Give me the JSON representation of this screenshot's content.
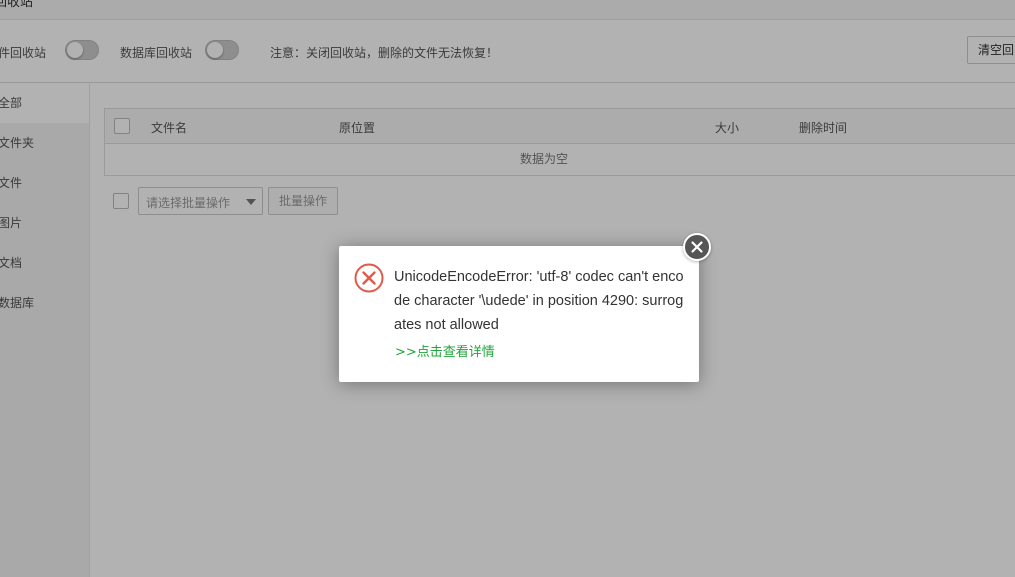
{
  "header": {
    "title": "回收站"
  },
  "options": {
    "file_recycle_label": "文件回收站",
    "db_recycle_label": "数据库回收站",
    "note": "注意：关闭回收站，删除的文件无法恢复！",
    "clear_button": "清空回收站"
  },
  "sidebar": {
    "items": [
      {
        "label": "全部"
      },
      {
        "label": "文件夹"
      },
      {
        "label": "文件"
      },
      {
        "label": "图片"
      },
      {
        "label": "文档"
      },
      {
        "label": "数据库"
      }
    ]
  },
  "table": {
    "columns": [
      "文件名",
      "原位置",
      "大小",
      "删除时间"
    ],
    "empty_text": "数据为空"
  },
  "batch": {
    "select_placeholder": "请选择批量操作",
    "button": "批量操作"
  },
  "dialog": {
    "message": "UnicodeEncodeError: 'utf-8' codec can't encode character '\\udede' in position 4290: surrogates not allowed",
    "detail_link": ">>点击查看详情"
  },
  "colors": {
    "error": "#e05a4a",
    "link": "#20a53a",
    "overlay": "rgba(0,0,0,0.3)"
  }
}
